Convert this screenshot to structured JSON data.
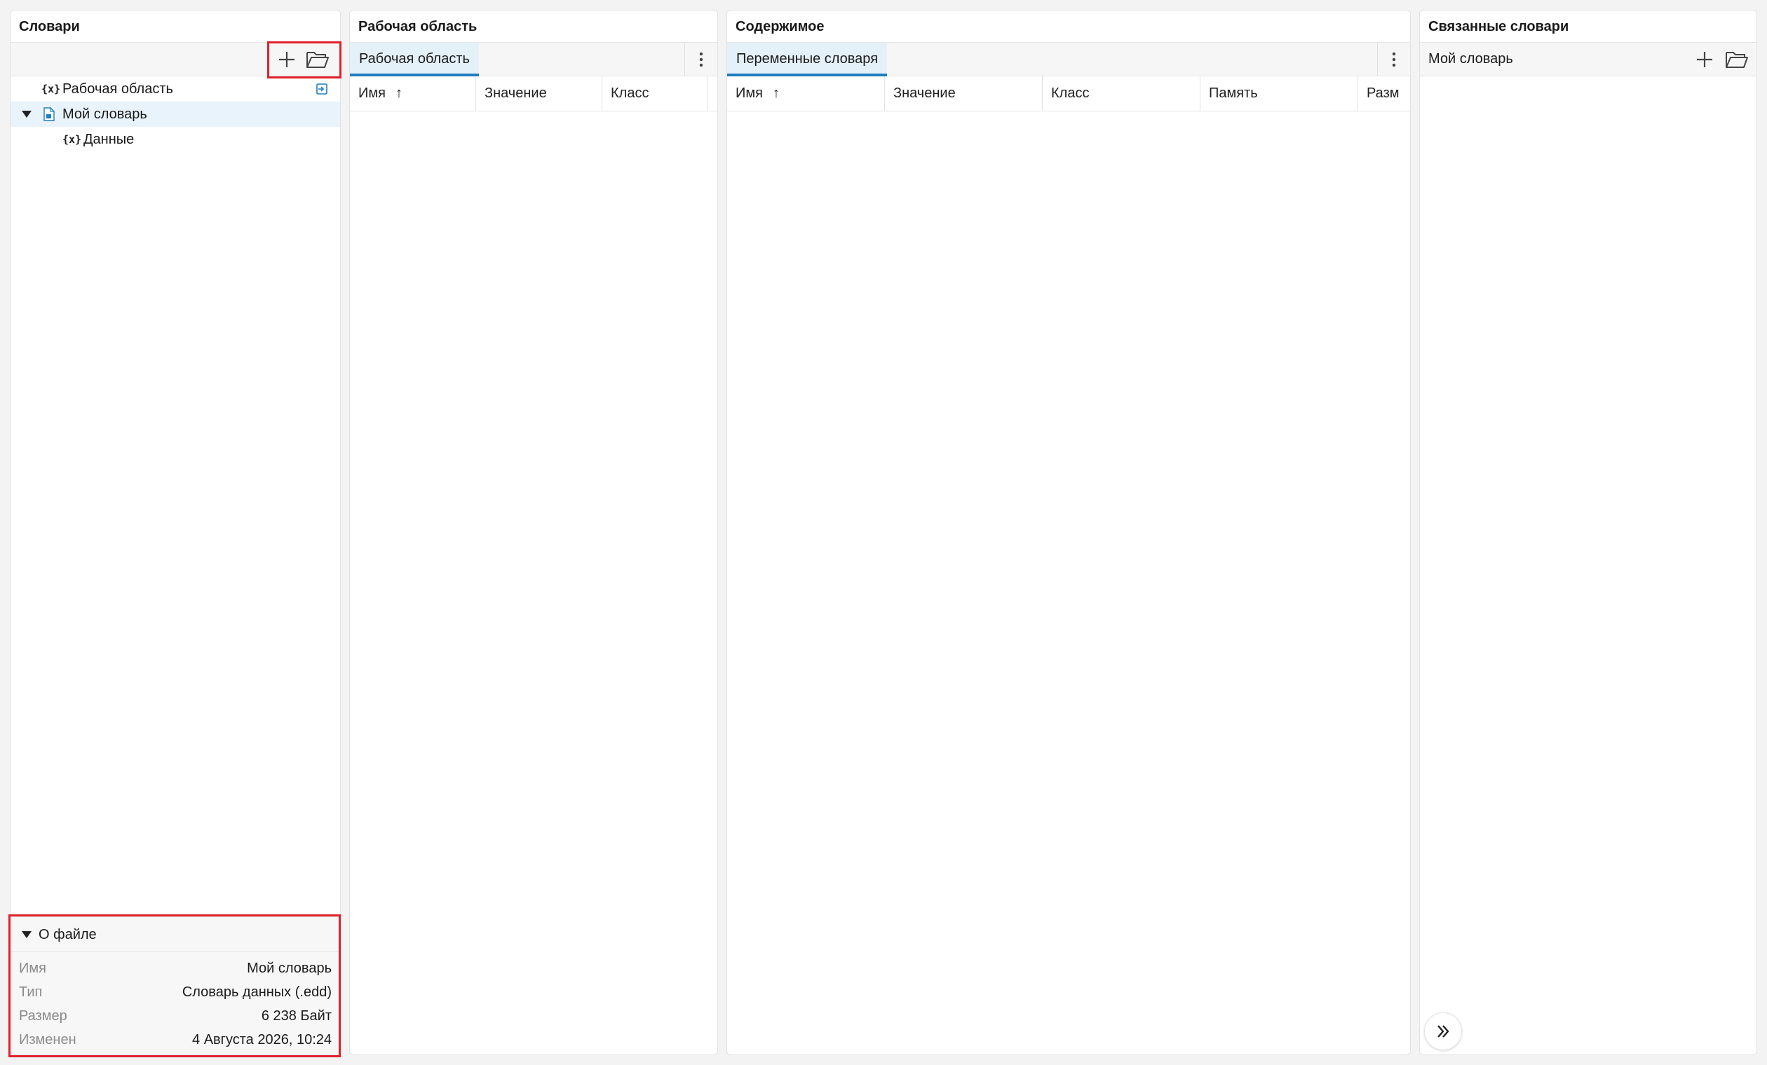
{
  "dictionaries_panel": {
    "title": "Словари",
    "tree": [
      {
        "icon": "{x}",
        "label": "Рабочая область"
      },
      {
        "icon": "doc",
        "label": "Мой словарь"
      },
      {
        "icon": "{x}",
        "label": "Данные"
      }
    ],
    "file_info": {
      "header": "О файле",
      "rows": [
        {
          "key": "Имя",
          "value": "Мой словарь"
        },
        {
          "key": "Тип",
          "value": "Словарь данных (.edd)"
        },
        {
          "key": "Размер",
          "value": "6 238 Байт"
        },
        {
          "key": "Изменен",
          "value": "4 Августа 2026, 10:24"
        }
      ]
    }
  },
  "workspace_panel": {
    "title": "Рабочая область",
    "tab": "Рабочая область",
    "columns": [
      "Имя",
      "Значение",
      "Класс"
    ],
    "sort_indicator": "↑"
  },
  "contents_panel": {
    "title": "Содержимое",
    "tab": "Переменные словаря",
    "columns": [
      "Имя",
      "Значение",
      "Класс",
      "Память",
      "Разм"
    ],
    "sort_indicator": "↑"
  },
  "linked_panel": {
    "title": "Связанные словари",
    "subheader": "Мой словарь"
  },
  "icons": {
    "add": "plus-icon",
    "open": "folder-open-icon",
    "more": "kebab-icon",
    "link": "link-arrow-icon",
    "dict": "dictionary-file-icon",
    "variable": "variable-icon",
    "expand_panel": "double-chevron-right-icon"
  },
  "colors": {
    "accent": "#1f7cbf",
    "selected_bg": "#e9f3fb",
    "tab_bg": "#e5f1f8",
    "highlight": "#e0212b"
  }
}
